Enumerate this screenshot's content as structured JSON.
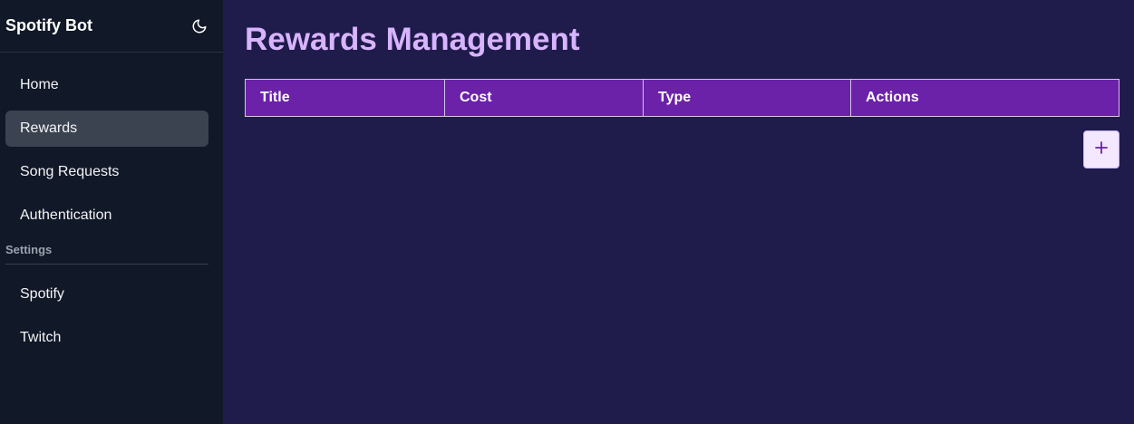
{
  "sidebar": {
    "title": "Spotify Bot",
    "theme_icon": "moon-icon",
    "items": [
      {
        "label": "Home",
        "active": false
      },
      {
        "label": "Rewards",
        "active": true
      },
      {
        "label": "Song Requests",
        "active": false
      },
      {
        "label": "Authentication",
        "active": false
      }
    ],
    "settings_label": "Settings",
    "settings_items": [
      {
        "label": "Spotify"
      },
      {
        "label": "Twitch"
      }
    ]
  },
  "main": {
    "title": "Rewards Management",
    "table": {
      "columns": [
        "Title",
        "Cost",
        "Type",
        "Actions"
      ],
      "rows": []
    },
    "add_icon": "plus-icon"
  },
  "colors": {
    "sidebar_bg": "#111827",
    "main_bg": "#1f1b4b",
    "accent": "#6b21a8",
    "title": "#d8b4fe"
  }
}
